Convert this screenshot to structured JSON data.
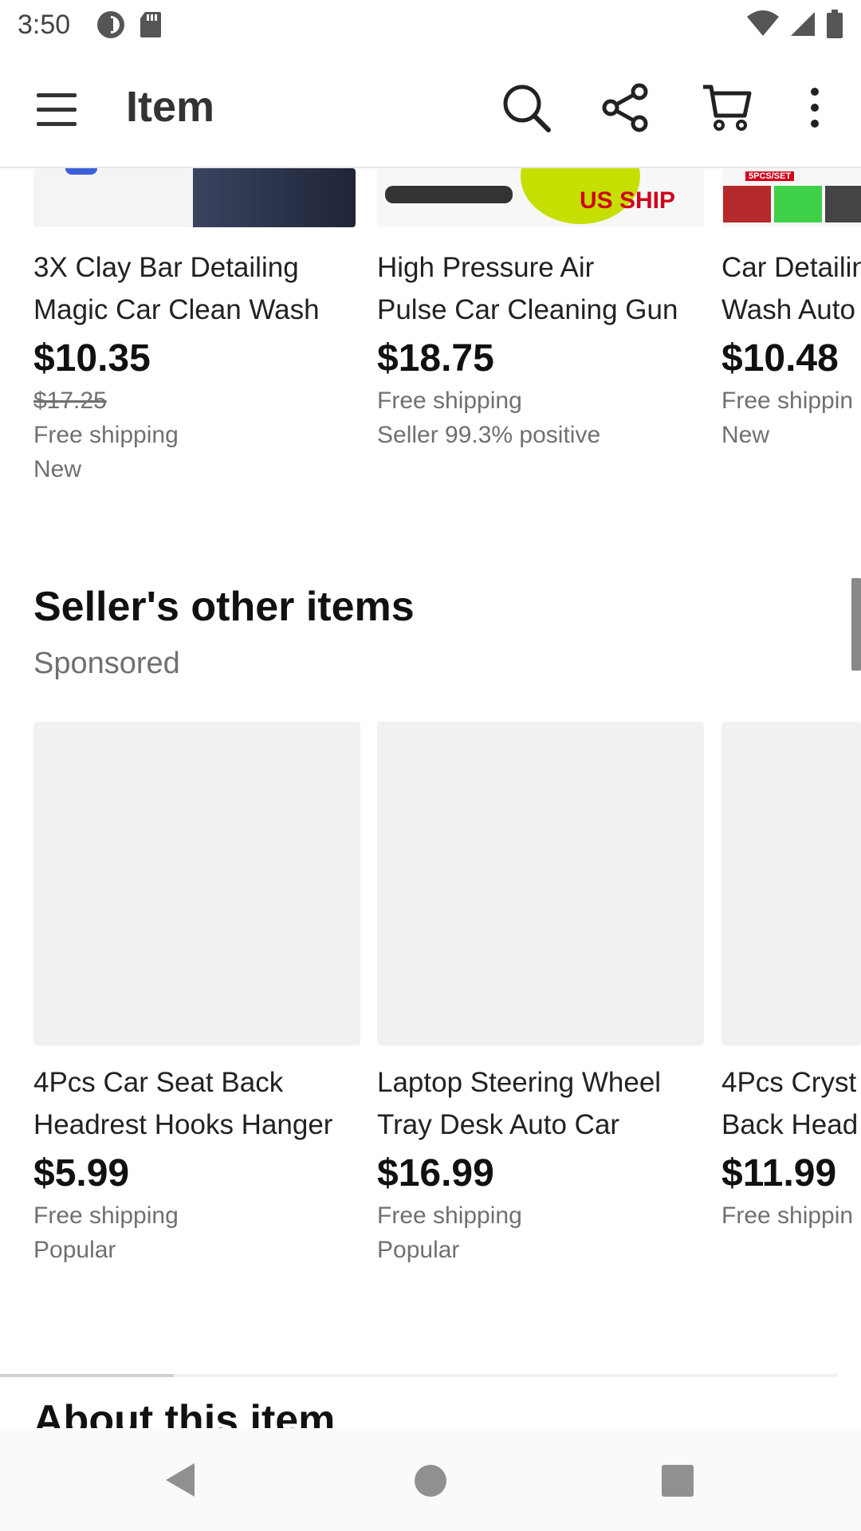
{
  "status_bar": {
    "time": "3:50",
    "icons_left": [
      "data-saver-icon",
      "sd-card-icon"
    ],
    "icons_right": [
      "wifi-icon",
      "cell-signal-icon",
      "battery-icon"
    ]
  },
  "app_bar": {
    "title": "Item",
    "icons": [
      "menu-icon",
      "search-icon",
      "share-icon",
      "cart-icon",
      "more-vert-icon"
    ]
  },
  "similar_items": [
    {
      "title_line1": "3X Clay Bar Detailing",
      "title_line2": "Magic Car Clean Wash",
      "price": "$10.35",
      "original_price": "$17.25",
      "meta1": "Free shipping",
      "meta2": "New"
    },
    {
      "title_line1": "High Pressure Air",
      "title_line2": "Pulse Car Cleaning Gun",
      "price": "$18.75",
      "meta1": "Free shipping",
      "meta2": "Seller 99.3% positive",
      "image_badge": "US SHIP"
    },
    {
      "title_line1": "Car Detailin",
      "title_line2": "Wash Auto",
      "price": "$10.48",
      "meta1": "Free shippin",
      "meta2": "New",
      "image_badge": "5PCS/SET"
    }
  ],
  "sellers_section": {
    "title": "Seller's other items",
    "subtitle": "Sponsored",
    "items": [
      {
        "title_line1": "4Pcs Car Seat Back",
        "title_line2": "Headrest Hooks Hanger",
        "price": "$5.99",
        "meta1": "Free shipping",
        "meta2": "Popular"
      },
      {
        "title_line1": "Laptop Steering Wheel",
        "title_line2": "Tray Desk Auto Car",
        "price": "$16.99",
        "meta1": "Free shipping",
        "meta2": "Popular"
      },
      {
        "title_line1": "4Pcs Cryst",
        "title_line2": "Back Head",
        "price": "$11.99",
        "meta1": "Free shippin"
      }
    ]
  },
  "about": {
    "title": "About this item"
  },
  "nav_bar": {
    "icons": [
      "back-icon",
      "home-icon",
      "recents-icon"
    ]
  },
  "colors": {
    "badge_red": "#d0021b",
    "sponge_green": "#c5e000",
    "placeholder": "#f1f1f1"
  }
}
